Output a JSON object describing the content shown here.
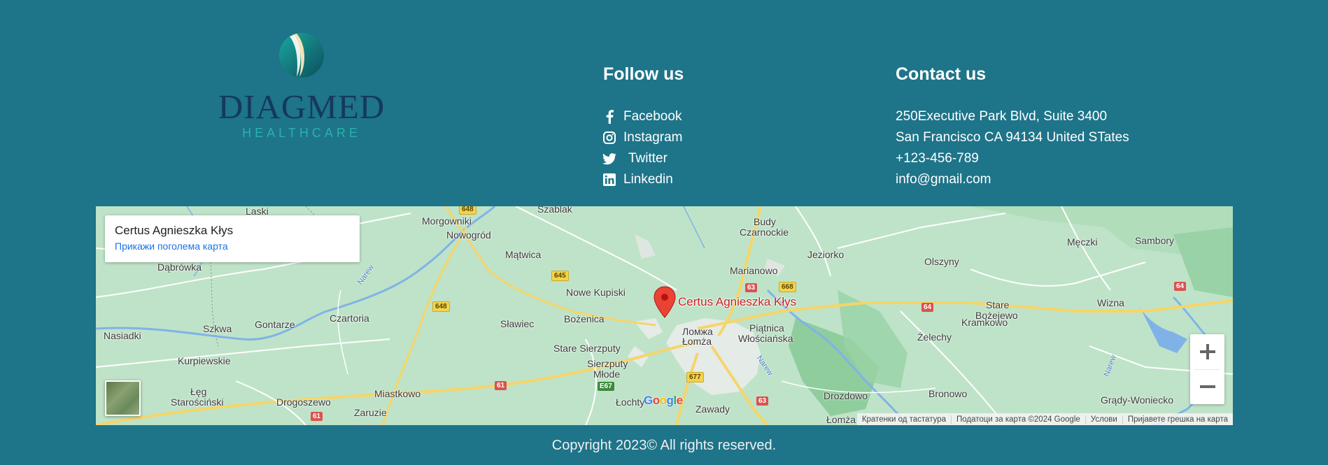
{
  "brand": {
    "name": "DIAGMED",
    "tagline": "HEALTHCARE"
  },
  "follow": {
    "title": "Follow us",
    "items": [
      {
        "label": "Facebook",
        "icon": "facebook-icon"
      },
      {
        "label": "Instagram",
        "icon": "instagram-icon"
      },
      {
        "label": "Twitter",
        "icon": "twitter-icon"
      },
      {
        "label": "Linkedin",
        "icon": "linkedin-icon"
      }
    ]
  },
  "contact": {
    "title": "Contact us",
    "address1": "250Executive Park Blvd, Suite 3400",
    "address2": "San Francisco CA 94134 United STates",
    "phone": "+123-456-789",
    "email": "info@gmail.com"
  },
  "map": {
    "card_title": "Certus Agnieszka Kłys",
    "card_link": "Прикажи поголема карта",
    "pin_label": "Certus Agnieszka Kłys",
    "places": {
      "laski": "Laski",
      "morgowniki": "Morgowniki",
      "szablak": "Szablak",
      "nowogrod": "Nowogród",
      "budy": "Budy",
      "czarnockie": "Czarnockie",
      "mecz": "Męczki",
      "sambory": "Sambory",
      "dabrowka": "Dąbrówka",
      "matwica": "Mątwica",
      "jeziorko": "Jeziorko",
      "olszyny": "Olszyny",
      "marianowo": "Marianowo",
      "narew1": "Narew",
      "nowe_kupiski": "Nowe Kupiski",
      "wizna": "Wizna",
      "stare": "Stare",
      "bozejewo": "Bożejewo",
      "nasiadki": "Nasiadki",
      "szkwa": "Szkwa",
      "gontarze": "Gontarze",
      "czartoria": "Czartoria",
      "slawiec": "Sławiec",
      "bozenica": "Bożenica",
      "lomza_cyr": "Ломжа",
      "lomza": "Łomża",
      "piatnica": "Piątnica",
      "wloscianska": "Włościańska",
      "kramkowo": "Kramkowo",
      "zelechy": "Żelechy",
      "kurpiewskie": "Kurpiewskie",
      "stare_sierzputy": "Stare Sierzputy",
      "sierzputy": "Sierzputy",
      "mlode": "Młode",
      "narew2": "Narew",
      "narew3": "Narew",
      "leg": "Łęg",
      "staroscinski": "Starościński",
      "miastkowo": "Miastkowo",
      "drogoszewo": "Drogoszewo",
      "zaruzie": "Zaruzie",
      "lochty": "Łochty",
      "zawady": "Zawady",
      "drozdowo": "Drozdowo",
      "bronowo": "Bronowo",
      "grady": "Grądy-Woniecko",
      "lomza2": "Łomża"
    },
    "roads": {
      "r648a": "648",
      "r645": "645",
      "r648b": "648",
      "r63a": "63",
      "r668": "668",
      "r64a": "64",
      "r64b": "64",
      "r61a": "61",
      "r61b": "61",
      "r677": "677",
      "e67": "E67",
      "r63b": "63"
    },
    "google": "Google",
    "attribution": {
      "shortcuts": "Кратенки од тастатура",
      "data": "Податоци за карта ©2024 Google",
      "terms": "Услови",
      "report": "Пријавете грешка на карта"
    }
  },
  "footer": {
    "copyright": "Copyright 2023© All rights reserved."
  }
}
